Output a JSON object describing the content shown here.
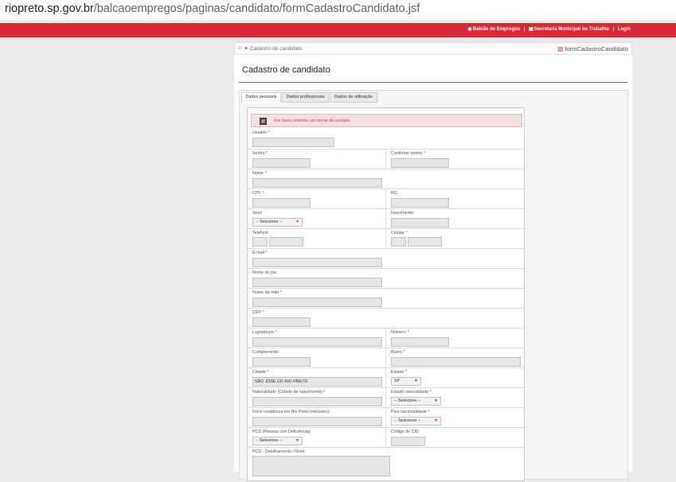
{
  "browser": {
    "url_host": "riopreto.sp.gov.br",
    "url_path": "/balcaoempregos/paginas/candidato/formCadastroCandidato.jsf"
  },
  "topbar": {
    "links": [
      "Balcão de Empregos",
      "Secretaria Municipal do Trabalho",
      "Login"
    ],
    "separator": "|"
  },
  "breadcrumb": {
    "label": "Cadastro de candidato",
    "form_id": "formCadastroCandidato"
  },
  "page_title": "Cadastro de candidato",
  "tabs": [
    "Dados pessoais",
    "Dados profissionais",
    "Dados de utilização"
  ],
  "alert": {
    "message": "Por favor, informe um nome de usuário."
  },
  "required_mark": "*",
  "fields": {
    "usuario": {
      "label": "Usuário",
      "value": ""
    },
    "senha": {
      "label": "Senha",
      "value": ""
    },
    "confirmar_senha": {
      "label": "Confirmar senha",
      "value": ""
    },
    "nome": {
      "label": "Nome",
      "value": ""
    },
    "cpf": {
      "label": "CPF",
      "value": ""
    },
    "rg": {
      "label": "RG",
      "value": ""
    },
    "sexo": {
      "label": "Sexo",
      "value": "-- Selecione --"
    },
    "nascimento": {
      "label": "Nascimento",
      "value": ""
    },
    "telefone": {
      "label": "Telefone",
      "value": ""
    },
    "celular": {
      "label": "Celular",
      "value": ""
    },
    "email": {
      "label": "E-mail",
      "value": ""
    },
    "nome_pai": {
      "label": "Nome do pai",
      "value": ""
    },
    "nome_mae": {
      "label": "Nome da mãe",
      "value": ""
    },
    "cep": {
      "label": "CEP",
      "value": ""
    },
    "logradouro": {
      "label": "Logradouro",
      "value": ""
    },
    "numero": {
      "label": "Número",
      "value": ""
    },
    "complemento": {
      "label": "Complemento",
      "value": ""
    },
    "bairro": {
      "label": "Bairro",
      "value": ""
    },
    "cidade": {
      "label": "Cidade",
      "value": "SÃO JOSÉ DO RIO PRETO"
    },
    "estado": {
      "label": "Estado",
      "value": "SP"
    },
    "naturalidade": {
      "label": "Naturalidade (Cidade de nascimento)",
      "value": ""
    },
    "estado_naturalidade": {
      "label": "Estado naturalidade",
      "value": "-- Selecione --"
    },
    "inicio_residencia": {
      "label": "Início residência em Rio Preto (mês/ano)",
      "value": ""
    },
    "pais_nacionalidade": {
      "label": "País nacionalidade",
      "value": "-- Selecione --"
    },
    "pcd": {
      "label": "PCD (Pessoa com Deficiência)",
      "value": "-- Selecione --"
    },
    "codigo_cid": {
      "label": "Código do CID",
      "value": ""
    },
    "pcd_detalhamento": {
      "label": "PCD - Detalhamento / Nível",
      "value": ""
    }
  },
  "colors": {
    "brand_red": "#d42b36",
    "alert_bg": "#f4dfe1",
    "alert_text": "#b94a48",
    "input_bg": "#e6e6e6"
  },
  "icons": [
    "home-icon",
    "form-icon",
    "close-icon",
    "dropdown-caret-icon"
  ]
}
